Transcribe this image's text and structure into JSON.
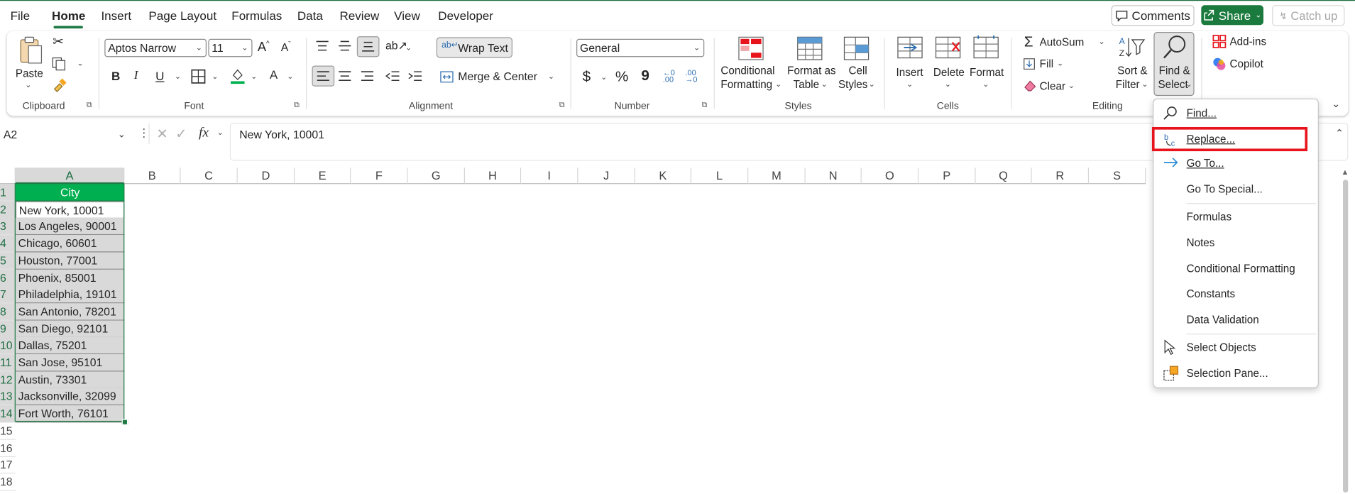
{
  "menu_tabs": [
    "File",
    "Home",
    "Insert",
    "Page Layout",
    "Formulas",
    "Data",
    "Review",
    "View",
    "Developer"
  ],
  "header_buttons": {
    "comments": "Comments",
    "share": "Share",
    "catch_up": "Catch up"
  },
  "ribbon": {
    "clipboard": {
      "paste": "Paste",
      "group": "Clipboard"
    },
    "font": {
      "name": "Aptos Narrow",
      "size": "11",
      "bold": "B",
      "italic": "I",
      "underline": "U",
      "group": "Font"
    },
    "alignment": {
      "wrap": "Wrap Text",
      "merge": "Merge & Center",
      "group": "Alignment"
    },
    "number": {
      "format": "General",
      "currency": "$",
      "percent": "%",
      "comma": "9",
      "group": "Number"
    },
    "styles": {
      "conditional_1": "Conditional",
      "conditional_2": "Formatting",
      "format_table_1": "Format as",
      "format_table_2": "Table",
      "cell_styles_1": "Cell",
      "cell_styles_2": "Styles",
      "group": "Styles"
    },
    "cells": {
      "insert": "Insert",
      "delete": "Delete",
      "format": "Format",
      "group": "Cells"
    },
    "editing": {
      "autosum": "AutoSum",
      "fill": "Fill",
      "clear": "Clear",
      "sort_1": "Sort &",
      "sort_2": "Filter",
      "find_1": "Find &",
      "find_2": "Select",
      "group": "Editing"
    },
    "addins": {
      "addins": "Add-ins",
      "copilot": "Copilot"
    }
  },
  "formula_bar": {
    "name_box": "A2",
    "formula": "New York, 10001"
  },
  "columns": [
    "A",
    "B",
    "C",
    "D",
    "E",
    "F",
    "G",
    "H",
    "I",
    "J",
    "K",
    "L",
    "M",
    "N",
    "O",
    "P",
    "Q",
    "R",
    "S"
  ],
  "rows": [
    "1",
    "2",
    "3",
    "4",
    "5",
    "6",
    "7",
    "8",
    "9",
    "10",
    "11",
    "12",
    "13",
    "14",
    "15",
    "16",
    "17",
    "18"
  ],
  "cells_a": [
    "City",
    "New York, 10001",
    "Los Angeles, 90001",
    "Chicago, 60601",
    "Houston, 77001",
    "Phoenix, 85001",
    "Philadelphia, 19101",
    "San Antonio, 78201",
    "San Diego, 92101",
    "Dallas, 75201",
    "San Jose, 95101",
    "Austin, 73301",
    "Jacksonville, 32099",
    "Fort Worth, 76101"
  ],
  "find_menu": [
    {
      "label": "Find...",
      "icon": "search-icon"
    },
    {
      "label": "Replace...",
      "icon": "replace-icon",
      "highlighted": true
    },
    {
      "label": "Go To...",
      "icon": "arrow-right-icon"
    },
    {
      "label": "Go To Special...",
      "icon": ""
    },
    {
      "label": "Formulas",
      "icon": ""
    },
    {
      "label": "Notes",
      "icon": ""
    },
    {
      "label": "Conditional Formatting",
      "icon": ""
    },
    {
      "label": "Constants",
      "icon": ""
    },
    {
      "label": "Data Validation",
      "icon": ""
    },
    {
      "label": "Select Objects",
      "icon": "cursor-icon"
    },
    {
      "label": "Selection Pane...",
      "icon": "selection-pane-icon"
    }
  ],
  "colors": {
    "excel_green": "#1b7a3d",
    "header_fill": "#00b050",
    "highlight_red": "#e8141c",
    "selected_fill": "#d9d9d9"
  }
}
